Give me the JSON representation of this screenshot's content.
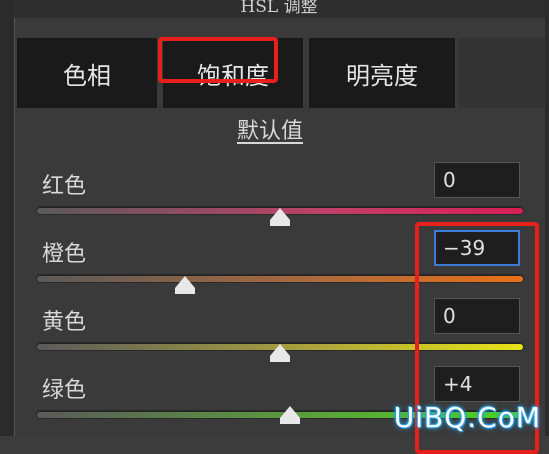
{
  "panel": {
    "title": "HSL 调整"
  },
  "tabs": [
    {
      "label": "色相",
      "active": false
    },
    {
      "label": "饱和度",
      "active": true
    },
    {
      "label": "明亮度",
      "active": false
    }
  ],
  "default_label": "默认值",
  "sliders": [
    {
      "label": "红色",
      "value": "0",
      "level": 0.5,
      "track": "linear-gradient(90deg,#5a5a5a,#c0406a 60%,#d81e55)"
    },
    {
      "label": "橙色",
      "value": "−39",
      "level": 0.305,
      "focused": true,
      "track": "linear-gradient(90deg,#5a5a5a,#b06a3a 60%,#e87018)"
    },
    {
      "label": "黄色",
      "value": "0",
      "level": 0.5,
      "track": "linear-gradient(90deg,#5a5a5a,#b0a83a 60%,#e8e418)"
    },
    {
      "label": "绿色",
      "value": "+4",
      "level": 0.52,
      "track": "linear-gradient(90deg,#5a5a5a,#5aa43a 60%,#4ad818)"
    }
  ],
  "watermark": "UiBQ.CoM",
  "colors": {
    "highlight": "#e8201b",
    "focus": "#3a7bd5"
  }
}
